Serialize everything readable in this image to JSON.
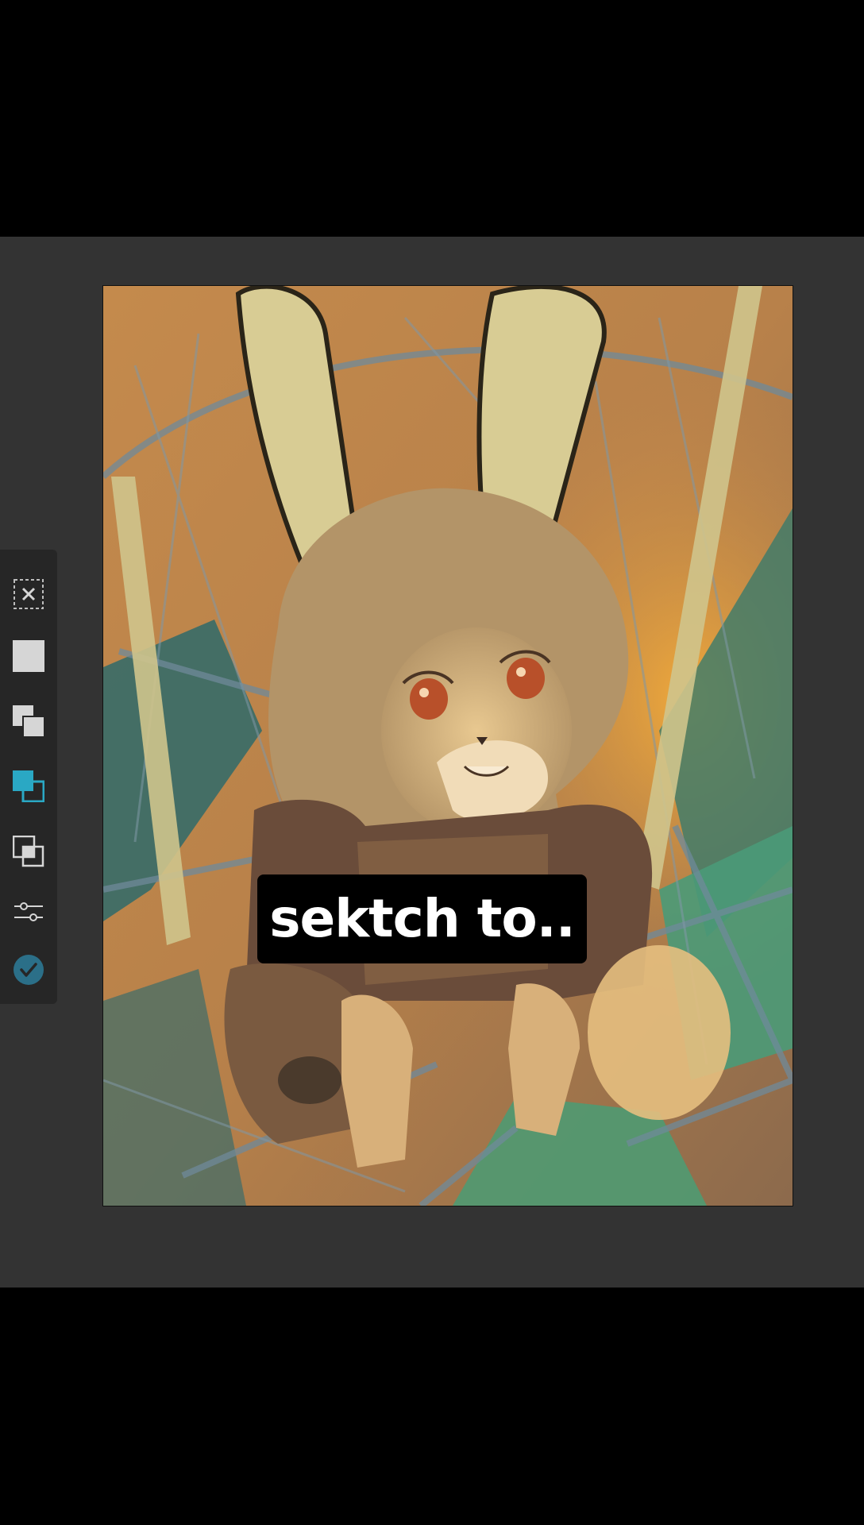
{
  "caption": {
    "text": "sektch to.."
  },
  "toolbar": {
    "items": [
      {
        "name": "deselect",
        "icon": "dashed-box-x-icon"
      },
      {
        "name": "fill-layer",
        "icon": "filled-square-icon"
      },
      {
        "name": "duplicate",
        "icon": "duplicate-squares-icon"
      },
      {
        "name": "copy-to-layer",
        "icon": "layer-copy-icon",
        "active": true
      },
      {
        "name": "merge",
        "icon": "merge-squares-icon"
      },
      {
        "name": "adjustments",
        "icon": "sliders-icon"
      },
      {
        "name": "confirm",
        "icon": "check-circle-icon"
      }
    ]
  },
  "colors": {
    "background": "#000000",
    "workspace": "#333333",
    "toolbar": "#262626",
    "accent": "#2aa8c4",
    "icon": "#d6d6d6",
    "confirm": "#2b6f88"
  }
}
